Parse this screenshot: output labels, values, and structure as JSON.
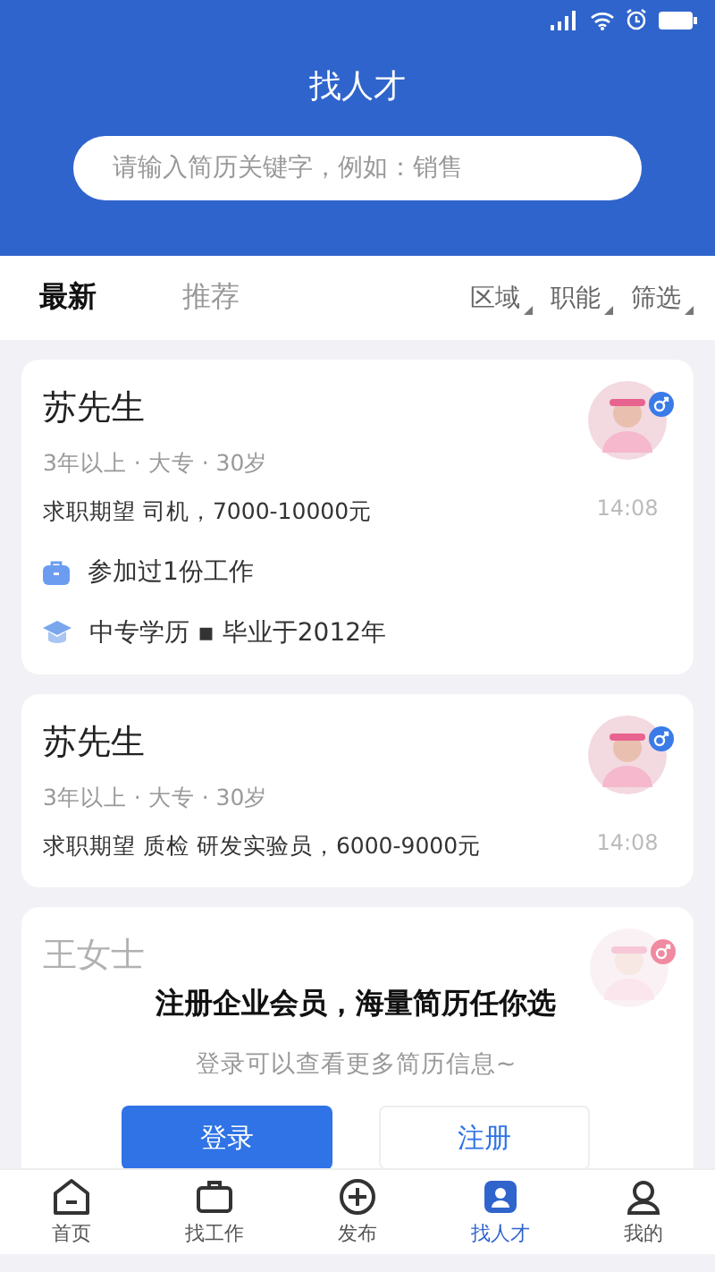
{
  "header": {
    "title": "找人才",
    "search": {
      "placeholder": "请输入简历关键字，例如：销售"
    }
  },
  "tabs": [
    {
      "label": "最新",
      "selected": true
    },
    {
      "label": "推荐",
      "selected": false
    }
  ],
  "filters": [
    "区域",
    "职能",
    "筛选"
  ],
  "resumes": [
    {
      "name": "苏先生",
      "meta": "3年以上 · 大专 · 30岁",
      "expectation": "求职期望 司机，7000-10000元",
      "time": "14:08",
      "color": "#3a7be8",
      "faded": false,
      "details": [
        {
          "kind": "work",
          "text": "参加过1份工作"
        },
        {
          "kind": "education",
          "text": "中专学历 ▪ 毕业于2012年"
        }
      ]
    },
    {
      "name": "苏先生",
      "meta": "3年以上 · 大专 · 30岁",
      "expectation": "求职期望 质检 研发实验员，6000-9000元",
      "time": "14:08",
      "color": "#3a7be8",
      "faded": false
    },
    {
      "name": "王女士",
      "color": "#f08aa0",
      "faded": true
    }
  ],
  "login_prompt": {
    "title": "注册企业会员，海量简历任你选",
    "subtitle": "登录可以查看更多简历信息~",
    "buttons": [
      {
        "kind": "primary",
        "label": "登录"
      },
      {
        "kind": "secondary",
        "label": "注册"
      }
    ]
  },
  "nav": [
    {
      "kind": "home",
      "label": "首页",
      "selected": false
    },
    {
      "kind": "jobs",
      "label": "找工作",
      "selected": false
    },
    {
      "kind": "post",
      "label": "发布",
      "selected": false
    },
    {
      "kind": "talent",
      "label": "找人才",
      "selected": true
    },
    {
      "kind": "me",
      "label": "我的",
      "selected": false
    }
  ]
}
